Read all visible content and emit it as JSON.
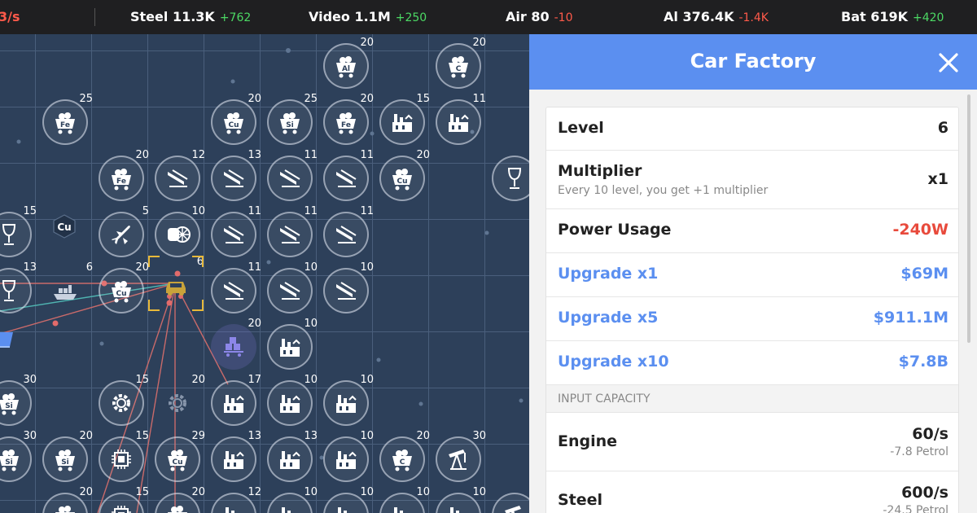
{
  "topbar": {
    "cut_text": "3/s",
    "resources": [
      {
        "name": "Steel",
        "value": "11.3K",
        "delta": "+762",
        "trend": "pos"
      },
      {
        "name": "Video",
        "value": "1.1M",
        "delta": "+250",
        "trend": "pos"
      },
      {
        "name": "Air",
        "value": "80",
        "delta": "-10",
        "trend": "neg"
      },
      {
        "name": "Al",
        "value": "376.4K",
        "delta": "-1.4K",
        "trend": "neg"
      },
      {
        "name": "Bat",
        "value": "619K",
        "delta": "+420",
        "trend": "pos"
      }
    ]
  },
  "colors": {
    "accent": "#5b8ff0",
    "negative": "#e84a3c",
    "positive": "#4cd964",
    "board": "#2d405a"
  },
  "board": {
    "nodes": [
      {
        "icon": "cart",
        "label": "Al",
        "level": "20"
      },
      {
        "icon": "cart",
        "label": "C",
        "level": "20"
      },
      {
        "icon": "cart",
        "label": "Fe",
        "level": "25"
      },
      {
        "icon": "cart",
        "label": "Cu",
        "level": "20"
      },
      {
        "icon": "cart",
        "label": "Si",
        "level": "25"
      },
      {
        "icon": "cart",
        "label": "Fe",
        "level": "20"
      },
      {
        "icon": "factory",
        "label": "",
        "level": "15"
      },
      {
        "icon": "factory",
        "label": "",
        "level": "11"
      },
      {
        "icon": "cart",
        "label": "Fe",
        "level": "20"
      },
      {
        "icon": "beam",
        "label": "",
        "level": "12"
      },
      {
        "icon": "beam",
        "label": "",
        "level": "13"
      },
      {
        "icon": "beam",
        "label": "",
        "level": "11"
      },
      {
        "icon": "beam",
        "label": "",
        "level": "11"
      },
      {
        "icon": "cart",
        "label": "Cu",
        "level": "20"
      },
      {
        "icon": "glass",
        "label": "",
        "level": ""
      },
      {
        "icon": "glass",
        "label": "",
        "level": "15"
      },
      {
        "icon": "plane",
        "label": "",
        "level": "5"
      },
      {
        "icon": "engine",
        "label": "",
        "level": "10"
      },
      {
        "icon": "beam",
        "label": "",
        "level": "11"
      },
      {
        "icon": "beam",
        "label": "",
        "level": "11"
      },
      {
        "icon": "beam",
        "label": "",
        "level": "11"
      },
      {
        "icon": "glass",
        "label": "",
        "level": "13"
      },
      {
        "icon": "ship",
        "label": "",
        "level": "6"
      },
      {
        "icon": "cart",
        "label": "Cu",
        "level": "20"
      },
      {
        "icon": "car",
        "label": "",
        "level": "6"
      },
      {
        "icon": "beam",
        "label": "",
        "level": "11"
      },
      {
        "icon": "beam",
        "label": "",
        "level": "10"
      },
      {
        "icon": "beam",
        "label": "",
        "level": "10"
      },
      {
        "icon": "book",
        "label": "",
        "level": ""
      },
      {
        "icon": "boxes",
        "label": "",
        "level": "20"
      },
      {
        "icon": "factory",
        "label": "",
        "level": "10"
      },
      {
        "icon": "cart",
        "label": "Si",
        "level": "30"
      },
      {
        "icon": "gear",
        "label": "",
        "level": "15"
      },
      {
        "icon": "gear",
        "label": "",
        "level": "20"
      },
      {
        "icon": "factory",
        "label": "",
        "level": "17"
      },
      {
        "icon": "factory",
        "label": "",
        "level": "10"
      },
      {
        "icon": "factory",
        "label": "",
        "level": "10"
      },
      {
        "icon": "cart",
        "label": "Si",
        "level": "30"
      },
      {
        "icon": "cart",
        "label": "Si",
        "level": "20"
      },
      {
        "icon": "chip",
        "label": "",
        "level": "15"
      },
      {
        "icon": "cart",
        "label": "Cu",
        "level": "29"
      },
      {
        "icon": "factory",
        "label": "",
        "level": "13"
      },
      {
        "icon": "factory",
        "label": "",
        "level": "13"
      },
      {
        "icon": "factory",
        "label": "",
        "level": "10"
      },
      {
        "icon": "cart",
        "label": "C",
        "level": "20"
      },
      {
        "icon": "oilpump",
        "label": "",
        "level": "30"
      },
      {
        "icon": "cart",
        "label": "Al",
        "level": "20"
      },
      {
        "icon": "chip",
        "label": "",
        "level": "15"
      },
      {
        "icon": "cart",
        "label": "Al",
        "level": "20"
      },
      {
        "icon": "factory",
        "label": "",
        "level": "12"
      },
      {
        "icon": "factory",
        "label": "",
        "level": "10"
      },
      {
        "icon": "factory",
        "label": "",
        "level": "10"
      },
      {
        "icon": "factory",
        "label": "",
        "level": "10"
      },
      {
        "icon": "factory",
        "label": "",
        "level": "10"
      },
      {
        "icon": "oilpump",
        "label": "",
        "level": ""
      }
    ],
    "hex_label": "Cu"
  },
  "panel": {
    "title": "Car Factory",
    "level_label": "Level",
    "level_value": "6",
    "multiplier_label": "Multiplier",
    "multiplier_note": "Every 10 level, you get +1 multiplier",
    "multiplier_value": "x1",
    "power_label": "Power Usage",
    "power_value": "-240W",
    "upgrades": [
      {
        "label": "Upgrade x1",
        "price": "$69M"
      },
      {
        "label": "Upgrade x5",
        "price": "$911.1M"
      },
      {
        "label": "Upgrade x10",
        "price": "$7.8B"
      }
    ],
    "input_capacity_header": "INPUT CAPACITY",
    "inputs": [
      {
        "label": "Engine",
        "rate": "60/s",
        "fuel": "-7.8 Petrol"
      },
      {
        "label": "Steel",
        "rate": "600/s",
        "fuel": "-24.5 Petrol"
      }
    ]
  }
}
